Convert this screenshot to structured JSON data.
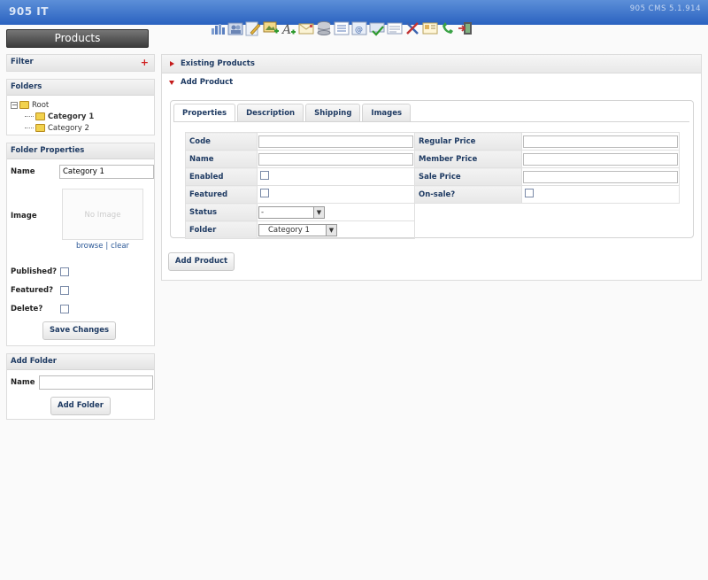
{
  "app": {
    "brand": "905 IT",
    "version": "905 CMS 5.1.914"
  },
  "toolbar": {
    "icons": [
      "chart-icon",
      "users-icon",
      "pencil-icon",
      "image-add-icon",
      "text-icon",
      "mail-icon",
      "database-icon",
      "list-icon",
      "email-icon",
      "check-icon",
      "document-icon",
      "tools-icon",
      "contact-icon",
      "phone-icon",
      "exit-icon"
    ]
  },
  "sidebar": {
    "products_label": "Products",
    "filter": {
      "title": "Filter",
      "plus": "+"
    },
    "folders": {
      "title": "Folders",
      "tree": [
        {
          "label": "Root"
        },
        {
          "label": "Category 1"
        },
        {
          "label": "Category 2"
        }
      ]
    },
    "folder_properties": {
      "title": "Folder Properties",
      "name_label": "Name",
      "name_value": "Category 1",
      "image_label": "Image",
      "no_image": "No Image",
      "browse": "browse",
      "separator": "|",
      "clear": "clear",
      "published_label": "Published?",
      "featured_label": "Featured?",
      "delete_label": "Delete?",
      "save_button": "Save Changes"
    },
    "add_folder": {
      "title": "Add Folder",
      "name_label": "Name",
      "name_value": "",
      "button": "Add Folder"
    }
  },
  "main": {
    "existing_products": "Existing Products",
    "add_product": "Add Product",
    "tabs": [
      "Properties",
      "Description",
      "Shipping",
      "Images"
    ],
    "form": {
      "code": "Code",
      "name": "Name",
      "enabled": "Enabled",
      "featured": "Featured",
      "status": "Status",
      "status_value": "-",
      "folder": "Folder",
      "folder_value": "Category 1",
      "regular_price": "Regular Price",
      "member_price": "Member Price",
      "sale_price": "Sale Price",
      "on_sale": "On-sale?"
    },
    "add_product_button": "Add Product"
  }
}
